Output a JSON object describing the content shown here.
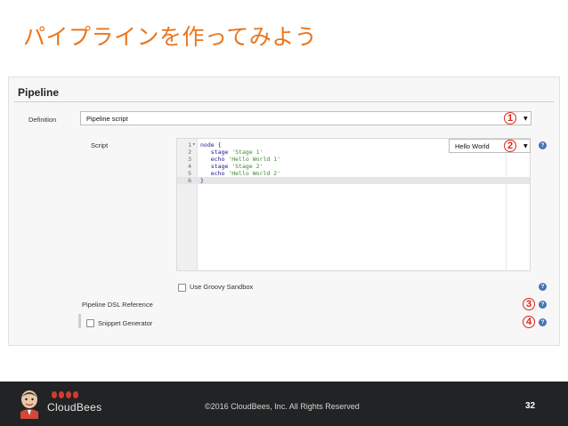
{
  "slide": {
    "title": "パイプラインを作ってみよう"
  },
  "panel": {
    "header": "Pipeline",
    "definition": {
      "label": "Definition",
      "value": "Pipeline script",
      "marker": "1"
    },
    "script": {
      "label": "Script",
      "sample_value": "Hello World",
      "marker": "2",
      "lines": [
        {
          "num": "1",
          "fold": "▾",
          "text": "node {",
          "str": ""
        },
        {
          "num": "2",
          "fold": "",
          "text": "   stage ",
          "str": "'Stage 1'"
        },
        {
          "num": "3",
          "fold": "",
          "text": "   echo ",
          "str": "'Hello World 1'"
        },
        {
          "num": "4",
          "fold": "",
          "text": "   stage ",
          "str": "'Stage 2'"
        },
        {
          "num": "5",
          "fold": "",
          "text": "   echo ",
          "str": "'Hello World 2'"
        },
        {
          "num": "6",
          "fold": "",
          "text": "}",
          "str": ""
        }
      ]
    },
    "sandbox": {
      "label": "Use Groovy Sandbox"
    },
    "dsl_reference": {
      "label": "Pipeline DSL Reference",
      "marker": "3"
    },
    "snippet_generator": {
      "label": "Snippet Generator",
      "marker": "4"
    },
    "help_glyph": "?"
  },
  "footer": {
    "logo_text": "CloudBees",
    "copyright": "©2016 CloudBees, Inc. All Rights Reserved",
    "page_number": "32"
  },
  "colors": {
    "title": "#e8761f",
    "marker": "#e2231a",
    "help": "#4a72b8",
    "footer_bg": "#222324"
  }
}
